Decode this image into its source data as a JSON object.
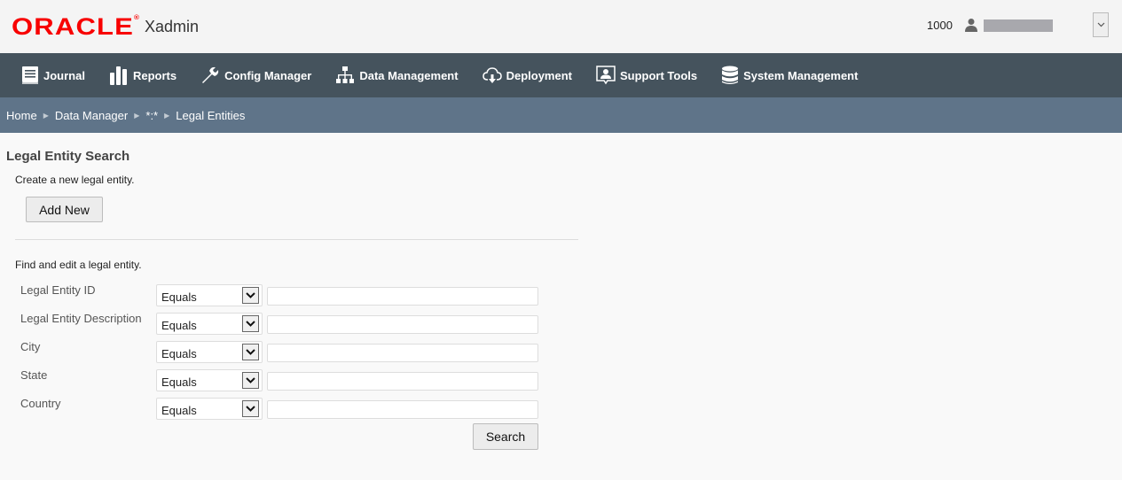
{
  "header": {
    "brand": "ORACLE",
    "brand_mark": "®",
    "app_name": "Xadmin",
    "user_id": "1000",
    "user_menu_icon": "chevron-down-icon"
  },
  "nav": {
    "items": [
      {
        "label": "Journal",
        "icon": "book-icon"
      },
      {
        "label": "Reports",
        "icon": "bar-chart-icon"
      },
      {
        "label": "Config Manager",
        "icon": "wrench-icon"
      },
      {
        "label": "Data Management",
        "icon": "hierarchy-icon"
      },
      {
        "label": "Deployment",
        "icon": "cloud-download-icon"
      },
      {
        "label": "Support Tools",
        "icon": "support-person-icon"
      },
      {
        "label": "System Management",
        "icon": "database-icon"
      }
    ]
  },
  "breadcrumb": {
    "items": [
      "Home",
      "Data Manager",
      "*:*",
      "Legal Entities"
    ]
  },
  "page": {
    "title": "Legal Entity Search",
    "create_text": "Create a new legal entity.",
    "add_new_label": "Add New",
    "find_text": "Find and edit a legal entity.",
    "search_label": "Search",
    "fields": [
      {
        "label": "Legal Entity ID",
        "operator": "Equals",
        "value": ""
      },
      {
        "label": "Legal Entity Description",
        "operator": "Equals",
        "value": ""
      },
      {
        "label": "City",
        "operator": "Equals",
        "value": ""
      },
      {
        "label": "State",
        "operator": "Equals",
        "value": ""
      },
      {
        "label": "Country",
        "operator": "Equals",
        "value": ""
      }
    ]
  },
  "colors": {
    "brand_red": "#f80000",
    "nav_bg": "#45535d",
    "breadcrumb_bg": "#5f7489"
  }
}
